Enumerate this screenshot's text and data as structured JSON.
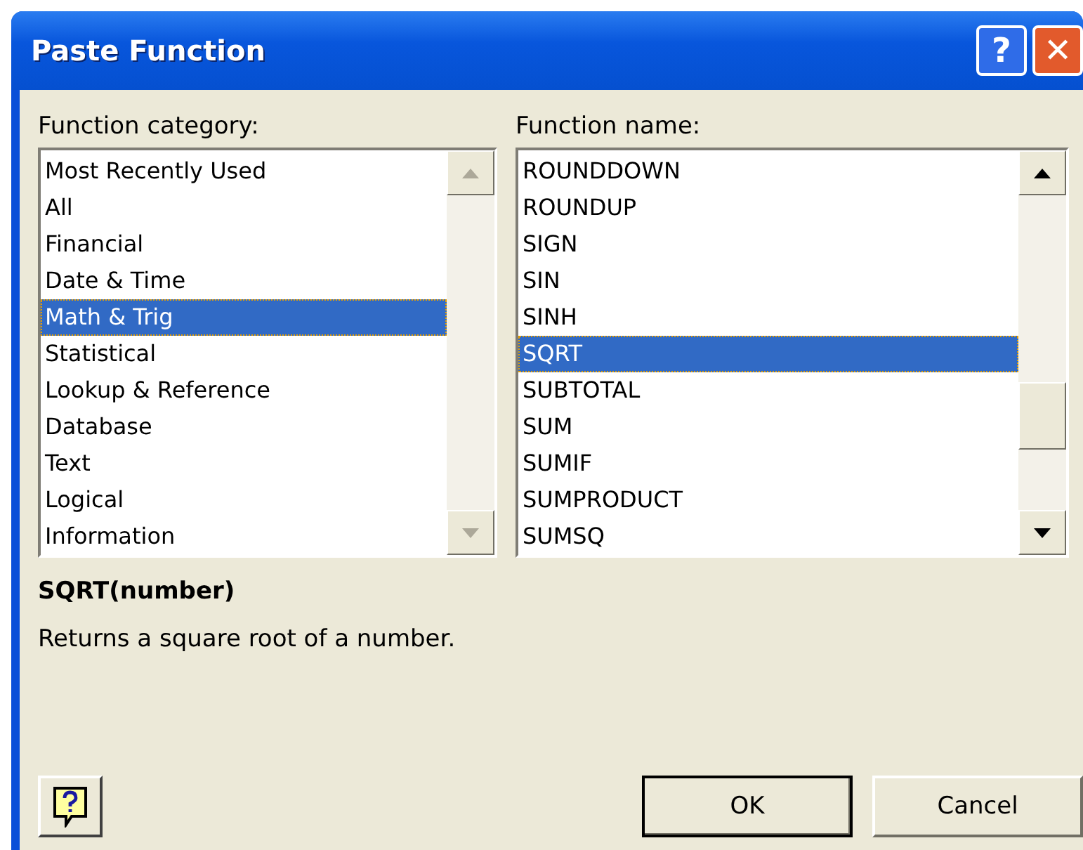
{
  "window": {
    "title": "Paste Function"
  },
  "title_buttons": [
    {
      "kind": "help",
      "label": "?"
    },
    {
      "kind": "close",
      "label": "✕"
    }
  ],
  "category_list": {
    "label": "Function category:",
    "scroll_enabled": false,
    "items": [
      {
        "label": "Most Recently Used",
        "selected": false
      },
      {
        "label": "All",
        "selected": false
      },
      {
        "label": "Financial",
        "selected": false
      },
      {
        "label": "Date & Time",
        "selected": false
      },
      {
        "label": "Math & Trig",
        "selected": true
      },
      {
        "label": "Statistical",
        "selected": false
      },
      {
        "label": "Lookup & Reference",
        "selected": false
      },
      {
        "label": "Database",
        "selected": false
      },
      {
        "label": "Text",
        "selected": false
      },
      {
        "label": "Logical",
        "selected": false
      },
      {
        "label": "Information",
        "selected": false
      }
    ]
  },
  "name_list": {
    "label": "Function name:",
    "scroll_enabled": true,
    "items": [
      {
        "label": "ROUNDDOWN",
        "selected": false
      },
      {
        "label": "ROUNDUP",
        "selected": false
      },
      {
        "label": "SIGN",
        "selected": false
      },
      {
        "label": "SIN",
        "selected": false
      },
      {
        "label": "SINH",
        "selected": false
      },
      {
        "label": "SQRT",
        "selected": true
      },
      {
        "label": "SUBTOTAL",
        "selected": false
      },
      {
        "label": "SUM",
        "selected": false
      },
      {
        "label": "SUMIF",
        "selected": false
      },
      {
        "label": "SUMPRODUCT",
        "selected": false
      },
      {
        "label": "SUMSQ",
        "selected": false
      }
    ]
  },
  "syntax": "SQRT(number)",
  "description": "Returns a square root of a number.",
  "buttons": [
    {
      "label": "OK",
      "default": true
    },
    {
      "label": "Cancel",
      "default": false
    }
  ]
}
